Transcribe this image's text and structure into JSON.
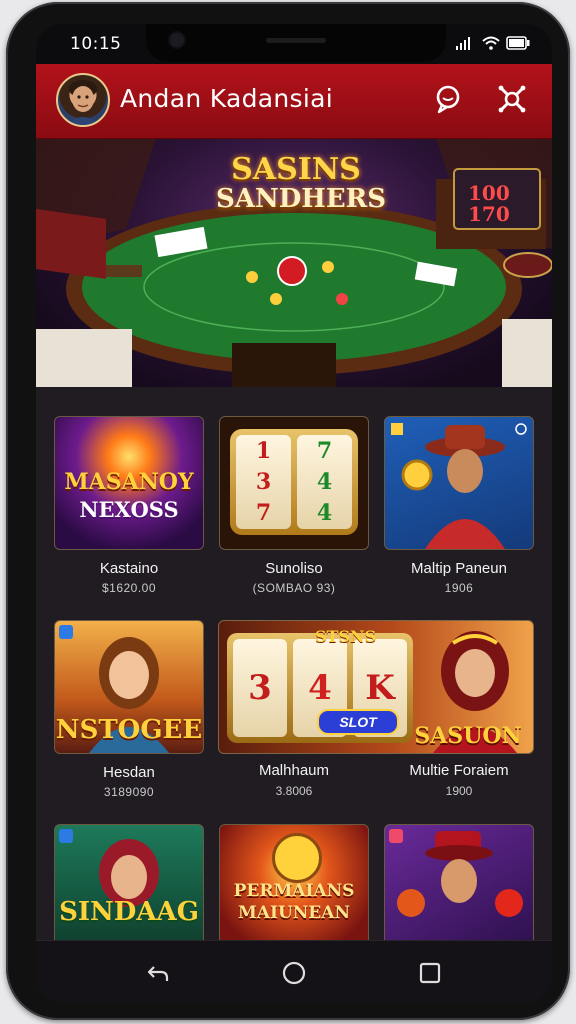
{
  "status_bar": {
    "time": "10:15",
    "icons": [
      "signal-icon",
      "wifi-icon",
      "battery-icon"
    ]
  },
  "header": {
    "title": "Andan Kadansiai",
    "icons": [
      "chat-icon",
      "settings-icon"
    ]
  },
  "banner": {
    "line1": "SASINS",
    "line2": "SANDHERS",
    "side_numbers": "100 170"
  },
  "games": [
    {
      "art_line1": "MASANOY",
      "art_line2": "NEXOSS",
      "name": "Kastaino",
      "sub": "$1620.00"
    },
    {
      "art_line1": "",
      "art_line2": "",
      "name": "Sunoliso",
      "sub": "(SOMBAO 93)"
    },
    {
      "art_line1": "",
      "art_line2": "",
      "name": "Maltip Paneun",
      "sub": "1906"
    },
    {
      "art_line1": "NSTOGEE",
      "art_line2": "",
      "name": "Hesdan",
      "sub": "3189090"
    },
    {
      "art_line1": "SASUON",
      "art_line2": "SLOT",
      "art_top": "STSNS",
      "name": "Malhhaum",
      "sub": "3.8006"
    },
    {
      "art_line1": "",
      "art_line2": "",
      "name": "Multie Foraiem",
      "sub": "1900"
    },
    {
      "art_line1": "SINDAAG",
      "art_line2": "",
      "name": "",
      "sub": ""
    },
    {
      "art_line1": "PERMAIANS",
      "art_line2": "MAIUNEAN",
      "name": "",
      "sub": ""
    },
    {
      "art_line1": "",
      "art_line2": "",
      "name": "",
      "sub": ""
    }
  ],
  "slot_symbols_small": [
    "1",
    "7",
    "3",
    "4",
    "7",
    "4"
  ],
  "slot_symbols_big": [
    "3",
    "4",
    "K"
  ],
  "colors": {
    "header_red": "#a3111a",
    "gold": "#ffd54a",
    "background": "#201c22"
  }
}
